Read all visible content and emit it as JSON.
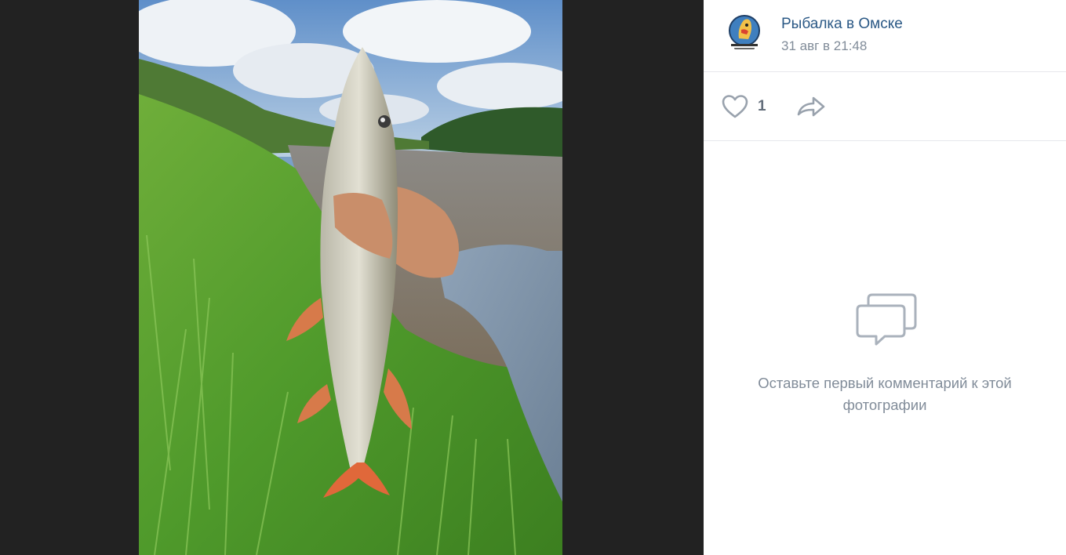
{
  "post": {
    "group_name": "Рыбалка в Омске",
    "date": "31 авг в 21:48",
    "avatar_icon": "fish-logo-icon"
  },
  "actions": {
    "like_icon": "heart-icon",
    "like_count": "1",
    "share_icon": "share-arrow-icon"
  },
  "comments": {
    "empty_icon": "comments-bubble-icon",
    "empty_text": "Оставьте первый комментарий к этой фотографии"
  },
  "colors": {
    "link": "#2a5885",
    "secondary": "#818c99",
    "icon": "#99a2ad",
    "background": "#222222"
  }
}
